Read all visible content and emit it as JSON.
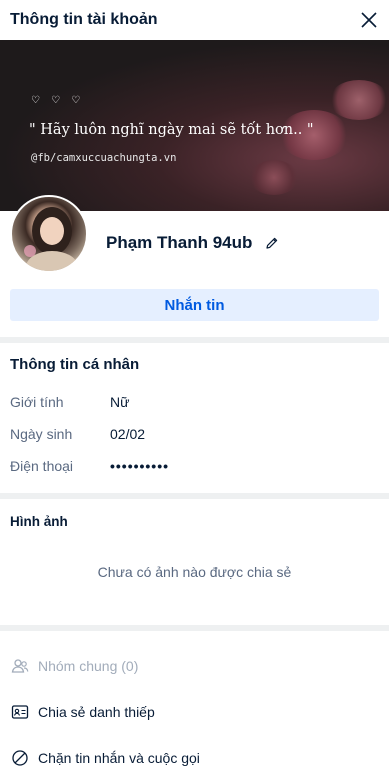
{
  "header": {
    "title": "Thông tin tài khoản"
  },
  "cover": {
    "hearts": "♡ ♡ ♡",
    "quote": "\" Hãy luôn nghĩ ngày mai sẽ tốt hơn.. \"",
    "credit": "@fb/camxuccuachungta.vn"
  },
  "profile": {
    "name": "Phạm Thanh 94ub"
  },
  "actions_top": {
    "message_label": "Nhắn tin"
  },
  "personal_info": {
    "title": "Thông tin cá nhân",
    "rows": [
      {
        "label": "Giới tính",
        "value": "Nữ"
      },
      {
        "label": "Ngày sinh",
        "value": "02/02"
      },
      {
        "label": "Điện thoại",
        "value": "••••••••••"
      }
    ]
  },
  "photos": {
    "title": "Hình ảnh",
    "empty_text": "Chưa có ảnh nào được chia sẻ"
  },
  "actions": [
    {
      "label": "Nhóm chung (0)",
      "icon": "group-icon"
    },
    {
      "label": "Chia sẻ danh thiếp",
      "icon": "contact-card-icon"
    },
    {
      "label": "Chặn tin nhắn và cuộc gọi",
      "icon": "block-icon"
    }
  ],
  "colors": {
    "primary": "#005ae0",
    "primary_bg": "#e5efff",
    "divider": "#eef0f1",
    "text": "#081c36",
    "muted": "#5a6981"
  }
}
